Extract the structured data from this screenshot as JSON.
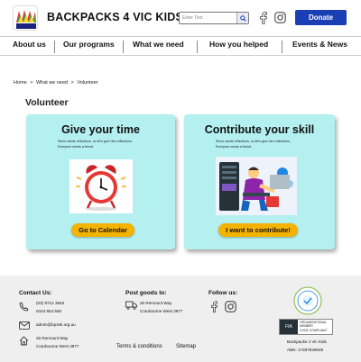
{
  "header": {
    "site_title": "BACKPACKS 4 VIC KIDS",
    "logo_text": "Backpacks 4 Vic Kids",
    "search_placeholder": "Enter Text",
    "donate_label": "Donate",
    "accent_color": "#1a3eb4"
  },
  "nav": {
    "items": [
      {
        "label": "About us"
      },
      {
        "label": "Our programs"
      },
      {
        "label": "What we need"
      },
      {
        "label": "How you helped"
      },
      {
        "label": "Events & News"
      }
    ]
  },
  "breadcrumb": {
    "items": [
      "Home",
      ">",
      "What we need",
      ">",
      "Volunteer"
    ]
  },
  "page_title": "Volunteer",
  "cards": [
    {
      "title": "Give your time",
      "desc_line1": "Steve wants reflections, so let's give him reflections.",
      "desc_line2": "Everyone needs a friend.",
      "image_icon": "alarm-clock-icon",
      "button_label": "Go to Calendar"
    },
    {
      "title": "Contribute your skill",
      "desc_line1": "Steve wants reflections, so let's give him reflections.",
      "desc_line2": "Everyone needs a friend.",
      "image_icon": "technician-illustration",
      "button_label": "I want to contribute!"
    }
  ],
  "footer": {
    "contact_heading": "Contact Us:",
    "phone1": "(03) 8712 3945",
    "phone2": "0444 554 560",
    "email": "admin@bp4vk.org.au",
    "address_line1": "26 Remount Way",
    "address_line2": "Cranbourne West 3977",
    "post_heading": "Post goods to:",
    "post_line1": "26 Remount Way",
    "post_line2": "Cranbourne West 3977",
    "follow_heading": "Follow us:",
    "terms_label": "Terms & conditions",
    "sitemap_label": "Sitemap",
    "fia_label": "FIA",
    "fia_line1": "ORGANISATIONAL",
    "fia_line2": "MEMBER",
    "fia_line3": "CODE COMPLIANT",
    "org_name": "Backpacks 4 Vic Kids",
    "abn": "ABN: 17287929649"
  }
}
